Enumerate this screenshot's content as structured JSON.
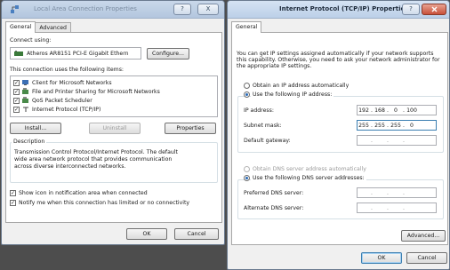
{
  "left": {
    "title": "Local Area Connection Properties",
    "tabs": [
      "General",
      "Advanced"
    ],
    "connect_using_label": "Connect using:",
    "adapter": "Atheros AR8151 PCI-E Gigabit Ethern",
    "configure": "Configure...",
    "items_label": "This connection uses the following items:",
    "items": [
      {
        "label": "Client for Microsoft Networks",
        "checked": true
      },
      {
        "label": "File and Printer Sharing for Microsoft Networks",
        "checked": true
      },
      {
        "label": "QoS Packet Scheduler",
        "checked": true
      },
      {
        "label": "Internet Protocol (TCP/IP)",
        "checked": true
      }
    ],
    "install": "Install...",
    "uninstall": "Uninstall",
    "properties": "Properties",
    "description_title": "Description",
    "description_text": [
      "Transmission Control Protocol/Internet Protocol. The default",
      "wide area network protocol that provides communication",
      "across diverse interconnected networks."
    ],
    "show_icon": "Show icon in notification area when connected",
    "notify": "Notify me when this connection has limited or no connectivity",
    "ok": "OK",
    "cancel": "Cancel",
    "help_glyph": "?",
    "close_glyph": "X"
  },
  "right": {
    "title": "Internet Protocol (TCP/IP) Properties",
    "tab": "General",
    "intro": [
      "You can get IP settings assigned automatically if your network supports",
      "this capability. Otherwise, you need to ask your network administrator for",
      "the appropriate IP settings."
    ],
    "obtain_auto": "Obtain an IP address automatically",
    "use_following": "Use the following IP address:",
    "ip_label": "IP address:",
    "ip_value": [
      "192",
      "168",
      "0",
      "100"
    ],
    "subnet_label": "Subnet mask:",
    "subnet_value": [
      "255",
      "255",
      "255",
      "0"
    ],
    "gateway_label": "Default gateway:",
    "dns_auto": "Obtain DNS server address automatically",
    "dns_use": "Use the following DNS server addresses:",
    "preferred_label": "Preferred DNS server:",
    "alternate_label": "Alternate DNS server:",
    "advanced": "Advanced...",
    "ok": "OK",
    "cancel": "Cancel",
    "help_glyph": "?",
    "dot": "."
  }
}
